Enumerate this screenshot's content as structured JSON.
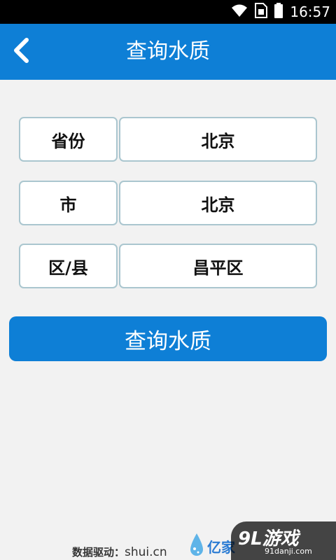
{
  "status_bar": {
    "time": "16:57",
    "icons": [
      "wifi-icon",
      "sim-card-icon",
      "battery-icon"
    ]
  },
  "app_bar": {
    "title": "查询水质",
    "back_icon": "chevron-left-icon"
  },
  "form": {
    "rows": [
      {
        "label": "省份",
        "value": "北京"
      },
      {
        "label": "市",
        "value": "北京"
      },
      {
        "label": "区/县",
        "value": "昌平区"
      }
    ]
  },
  "query_button": {
    "label": "查询水质"
  },
  "footer": {
    "credit_label": "数据驱动：",
    "credit_domain": "shui.cn",
    "logo_text": "亿家"
  },
  "watermark": {
    "main": "9L游戏",
    "sub": "91danji.com"
  },
  "colors": {
    "primary": "#0e7fd6",
    "background": "#f2f2f2",
    "field_border": "#aac6cf"
  }
}
